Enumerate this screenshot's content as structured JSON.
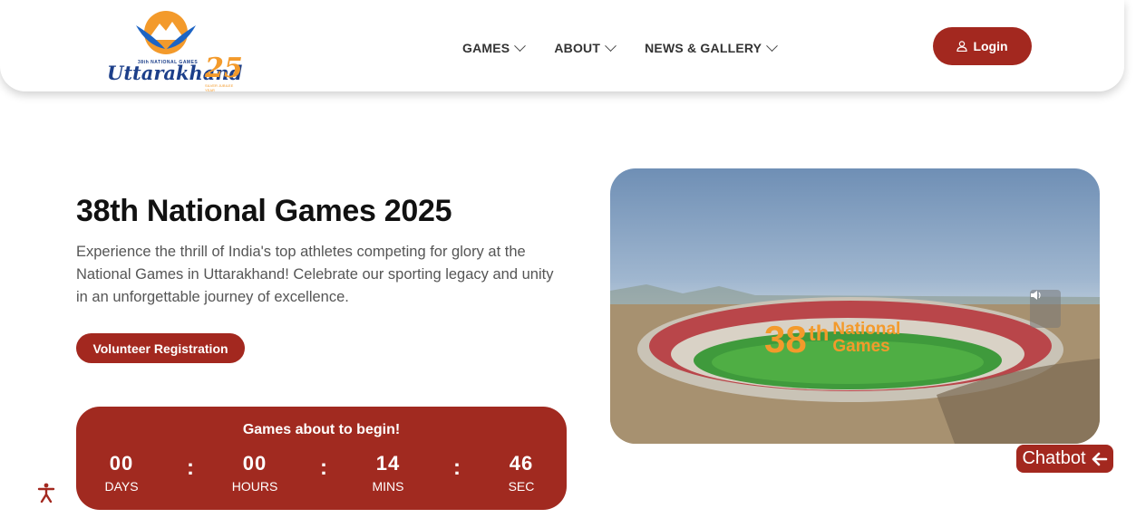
{
  "header": {
    "logo": {
      "top_text": "38th NATIONAL GAMES",
      "name": "Uttarakhand",
      "number": "25",
      "tag": "SILVER JUBILEE YEAR"
    },
    "nav": [
      {
        "label": "GAMES"
      },
      {
        "label": "ABOUT"
      },
      {
        "label": "NEWS & GALLERY"
      }
    ],
    "login_label": "Login"
  },
  "hero": {
    "title": "38th National Games 2025",
    "description": "Experience the thrill of India's top athletes competing for glory at the National Games in Uttarakhand! Celebrate our sporting legacy and unity in an unforgettable journey of excellence.",
    "volunteer_label": "Volunteer Registration"
  },
  "countdown": {
    "title": "Games about to begin!",
    "units": [
      {
        "value": "00",
        "label": "DAYS"
      },
      {
        "value": "00",
        "label": "HOURS"
      },
      {
        "value": "14",
        "label": "MINS"
      },
      {
        "value": "46",
        "label": "SEC"
      }
    ],
    "separator": ":"
  },
  "video": {
    "overlay_num": "38",
    "overlay_sup": "th",
    "overlay_line1": "National",
    "overlay_line2": "Games",
    "mute_icon": "speaker-icon"
  },
  "chatbot_label": "Chatbot",
  "colors": {
    "brand": "#a3281f",
    "accent": "#f39a2b",
    "logo_blue": "#1c3f8a"
  }
}
